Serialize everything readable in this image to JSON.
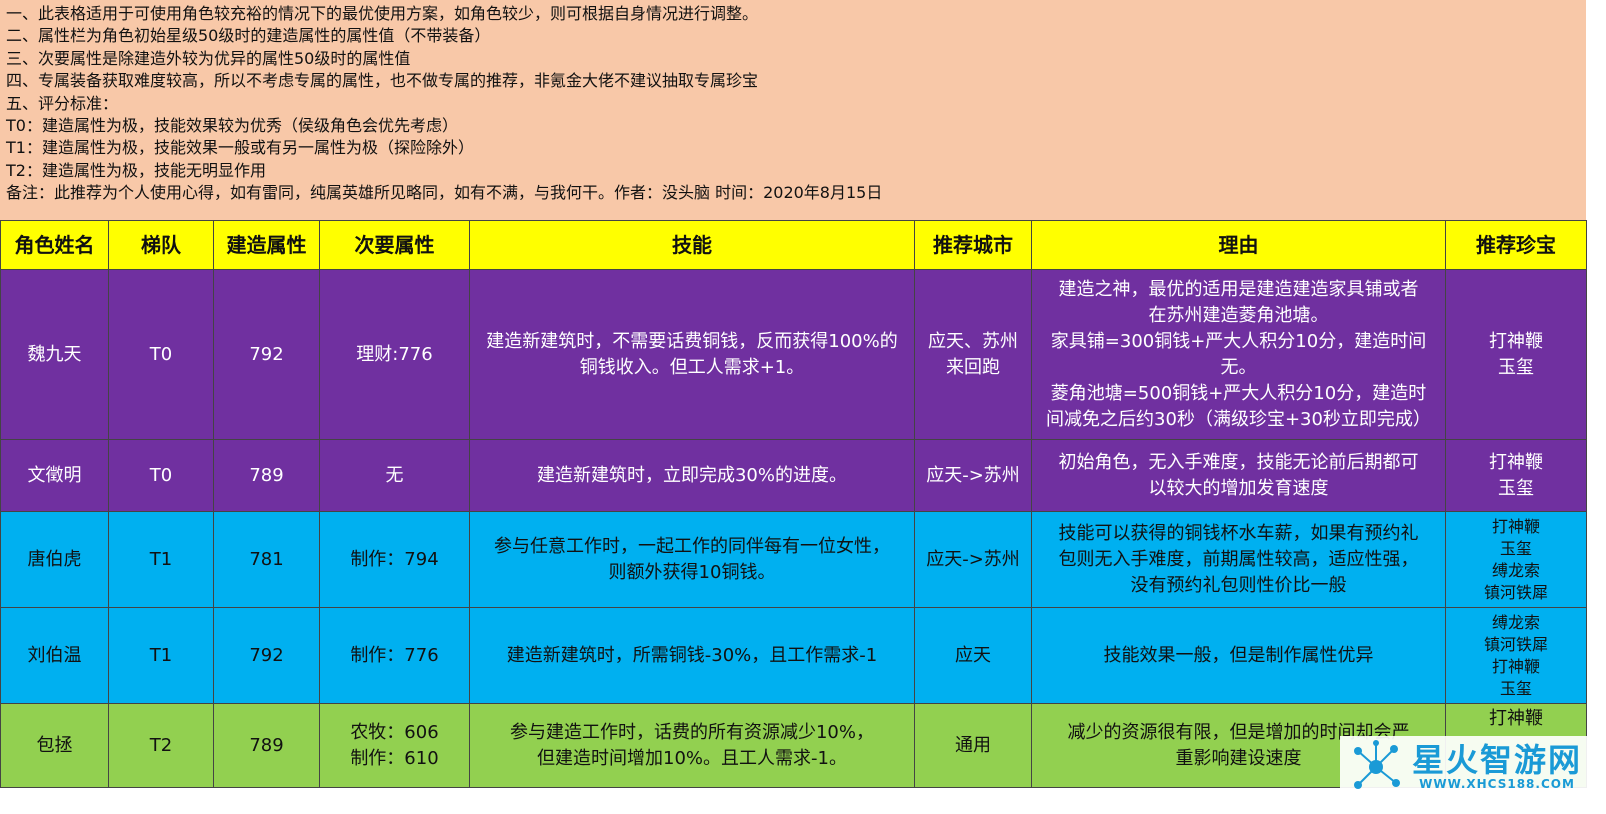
{
  "notes": [
    "一、此表格适用于可使用角色较充裕的情况下的最优使用方案，如角色较少，则可根据自身情况进行调整。",
    "二、属性栏为角色初始星级50级时的建造属性的属性值（不带装备）",
    "三、次要属性是除建造外较为优异的属性50级时的属性值",
    "四、专属装备获取难度较高，所以不考虑专属的属性，也不做专属的推荐，非氪金大佬不建议抽取专属珍宝",
    "五、评分标准：",
    "T0：建造属性为极，技能效果较为优秀（侯级角色会优先考虑）",
    "T1：建造属性为极，技能效果一般或有另一属性为极（探险除外）",
    "T2：建造属性为极，技能无明显作用",
    "备注：此推荐为个人使用心得，如有雷同，纯属英雄所见略同，如有不满，与我何干。作者：没头脑 时间：2020年8月15日"
  ],
  "table": {
    "headers": [
      "角色姓名",
      "梯队",
      "建造属性",
      "次要属性",
      "技能",
      "推荐城市",
      "理由",
      "推荐珍宝"
    ],
    "rows": [
      {
        "name": "魏九天",
        "tier": "T0",
        "build": "792",
        "secondary": [
          "理财:776"
        ],
        "skill": [
          "建造新建筑时，不需要话费铜钱，反而获得100%的",
          "铜钱收入。但工人需求+1。"
        ],
        "city": [
          "应天、苏州",
          "来回跑"
        ],
        "reason": [
          "建造之神，最优的适用是建造建造家具铺或者",
          "在苏州建造菱角池塘。",
          "家具铺=300铜钱+严大人积分10分，建造时间",
          "无。",
          "菱角池塘=500铜钱+严大人积分10分，建造时",
          "间减免之后约30秒（满级珍宝+30秒立即完成）"
        ],
        "treasure": [
          "打神鞭",
          "玉玺"
        ]
      },
      {
        "name": "文徵明",
        "tier": "T0",
        "build": "789",
        "secondary": [
          "无"
        ],
        "skill": [
          "建造新建筑时，立即完成30%的进度。"
        ],
        "city": [
          "应天->苏州"
        ],
        "reason": [
          "初始角色，无入手难度，技能无论前后期都可",
          "以较大的增加发育速度"
        ],
        "treasure": [
          "打神鞭",
          "玉玺"
        ]
      },
      {
        "name": "唐伯虎",
        "tier": "T1",
        "build": "781",
        "secondary": [
          "制作：794"
        ],
        "skill": [
          "参与任意工作时，一起工作的同伴每有一位女性，",
          "则额外获得10铜钱。"
        ],
        "city": [
          "应天->苏州"
        ],
        "reason": [
          "技能可以获得的铜钱杯水车薪，如果有预约礼",
          "包则无入手难度，前期属性较高，适应性强，",
          "没有预约礼包则性价比一般"
        ],
        "treasure": [
          "打神鞭",
          "玉玺",
          "缚龙索",
          "镇河铁犀"
        ]
      },
      {
        "name": "刘伯温",
        "tier": "T1",
        "build": "792",
        "secondary": [
          "制作：776"
        ],
        "skill": [
          "建造新建筑时，所需铜钱-30%，且工作需求-1"
        ],
        "city": [
          "应天"
        ],
        "reason": [
          "技能效果一般，但是制作属性优异"
        ],
        "treasure": [
          "缚龙索",
          "镇河铁犀",
          "打神鞭",
          "玉玺"
        ]
      },
      {
        "name": "包拯",
        "tier": "T2",
        "build": "789",
        "secondary": [
          "农牧：606",
          "制作：610"
        ],
        "skill": [
          "参与建造工作时，话费的所有资源减少10%，",
          "但建造时间增加10%。且工人需求-1。"
        ],
        "city": [
          "通用"
        ],
        "reason": [
          "减少的资源很有限，但是增加的时间却会严",
          "重影响建设速度"
        ],
        "treasure": [
          "打神鞭"
        ]
      }
    ]
  },
  "watermark": {
    "title": "星火智游网",
    "url": "WWW.XHCS188.COM",
    "icon": "network-logo-icon"
  }
}
